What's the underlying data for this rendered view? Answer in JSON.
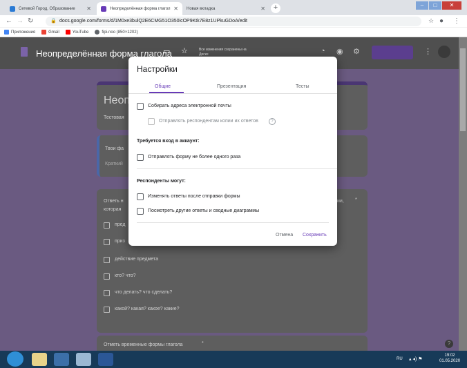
{
  "browser": {
    "tabs": [
      {
        "title": "Сетевой Город. Образование"
      },
      {
        "title": "Неопределённая форма глагол"
      },
      {
        "title": "Новая вкладка"
      }
    ],
    "url": "docs.google.com/forms/d/1M0xe3bulQ2E6CMG51O350icOP9Ktk7E8z1UPkuGDoA/edit",
    "bookmarks": [
      "Приложения",
      "Gmail",
      "YouTube",
      "fipi-noo (850×1202)"
    ]
  },
  "form": {
    "title": "Неопределённая форма глагола",
    "status": "Все изменения сохранены на Диске",
    "card_title_partial": "Неоп",
    "card_desc_partial": "Тестовая",
    "name_q_partial": "Твои фа",
    "name_q_hint_partial": "Краткий",
    "q1_text_partial": "Ответь н",
    "q1_text_partial2": "которая",
    "q1_right_partial": "ии,",
    "q1_required": "*",
    "options": [
      "пред",
      "приз",
      "действие предмета",
      "кто? что?",
      "что делать? что сделать?",
      "какой? какая? какое? какие?"
    ],
    "q2_text": "Отметь временные формы глагола",
    "q2_required": "*"
  },
  "dialog": {
    "title": "Настройки",
    "tabs": [
      "Общие",
      "Презентация",
      "Тесты"
    ],
    "collect_emails": "Собирать адреса электронной почты",
    "send_copies": "Отправлять респондентам копии их ответов",
    "help_icon": "?",
    "login_header": "Требуется вход в аккаунт:",
    "one_response": "Отправлять форму не более одного раза",
    "respondents_header": "Респонденты могут:",
    "edit_after": "Изменять ответы после отправки формы",
    "see_summary": "Посмотреть другие ответы и сводные диаграммы",
    "cancel": "Отмена",
    "save": "Сохранить"
  },
  "taskbar": {
    "lang": "RU",
    "time": "19:02",
    "date": "01.05.2020"
  },
  "colors": {
    "accent": "#673ab7",
    "overlay": "#6a5a81"
  }
}
